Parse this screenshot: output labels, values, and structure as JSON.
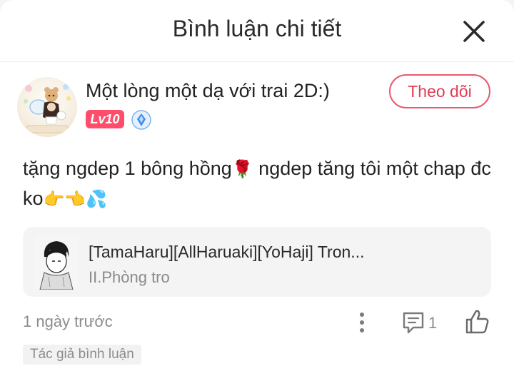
{
  "header": {
    "title": "Bình luận chi tiết",
    "close_icon": "close-icon"
  },
  "user": {
    "name": "Một lòng một dạ với trai 2D:)",
    "level": "Lv10",
    "vip_icon": "vip-diamond-icon",
    "follow_label": "Theo dõi"
  },
  "comment": {
    "text_part1": "tặng ngdep 1 bông hồng",
    "rose_emoji": "🌹",
    "text_part2": " ngdep tăng tôi một chap đc ko",
    "trailing_emojis": "👉👈💦"
  },
  "chapter": {
    "title": "[TamaHaru][AllHaruaki][YoHaji] Tron...",
    "subtitle": "II.Phòng tro"
  },
  "footer": {
    "timestamp": "1 ngày trước",
    "reply_count": "1",
    "author_tag": "Tác giả bình luận"
  },
  "colors": {
    "accent": "#e23a55",
    "level_badge": "#ff4d6a",
    "vip": "#3a8ef0",
    "muted_text": "#8c8c8c"
  }
}
